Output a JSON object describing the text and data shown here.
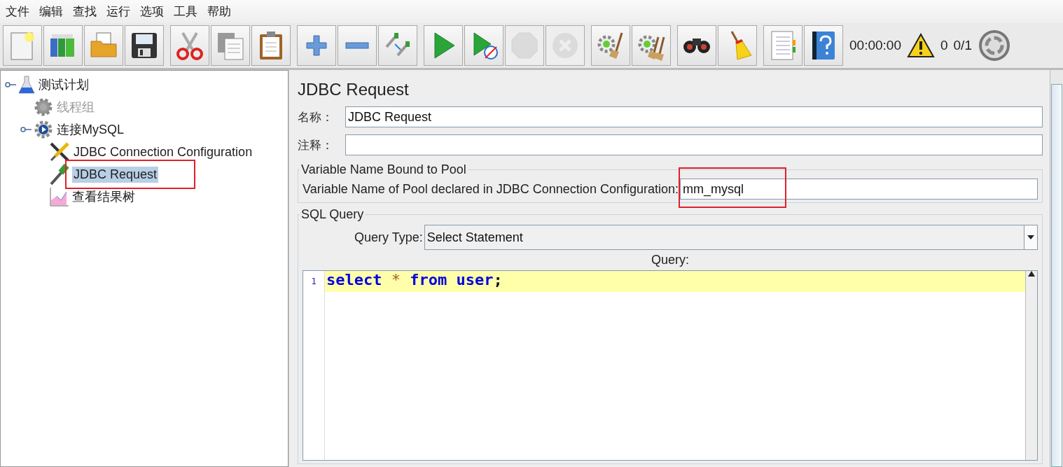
{
  "menu": [
    "文件",
    "编辑",
    "查找",
    "运行",
    "选项",
    "工具",
    "帮助"
  ],
  "toolbar": {
    "groups": [
      [
        {
          "disabled": false
        },
        {
          "disabled": false
        },
        {
          "disabled": false
        },
        {
          "disabled": false
        }
      ],
      [
        {
          "disabled": false
        },
        {
          "disabled": false
        },
        {
          "disabled": false
        }
      ],
      [
        {
          "disabled": false
        },
        {
          "disabled": false
        },
        {
          "disabled": false
        }
      ],
      [
        {
          "disabled": false
        },
        {
          "disabled": false
        },
        {
          "disabled": true
        },
        {
          "disabled": true
        }
      ],
      [
        {
          "disabled": false
        },
        {
          "disabled": false
        }
      ],
      [
        {
          "disabled": false
        },
        {
          "disabled": false
        }
      ],
      [
        {
          "disabled": false
        },
        {
          "disabled": false
        }
      ]
    ],
    "timer": "00:00:00",
    "warnings": "0",
    "threads": "0/1"
  },
  "tree": [
    {
      "label": "测试计划",
      "disabled": false,
      "selected": false,
      "highlighted": false,
      "children": [
        {
          "label": "线程组",
          "disabled": true,
          "selected": false,
          "highlighted": false
        },
        {
          "label": "连接MySQL",
          "disabled": false,
          "selected": false,
          "highlighted": false,
          "children": [
            {
              "label": "JDBC Connection Configuration",
              "disabled": false,
              "selected": false,
              "highlighted": false
            },
            {
              "label": "JDBC Request",
              "disabled": false,
              "selected": true,
              "highlighted": true
            },
            {
              "label": "查看结果树",
              "disabled": false,
              "selected": false,
              "highlighted": false
            }
          ]
        }
      ]
    }
  ],
  "panel": {
    "title": "JDBC Request",
    "name": {
      "label": "名称：",
      "value": "JDBC Request"
    },
    "comment": {
      "label": "注释："
    },
    "pool_section": {
      "title": "Variable Name Bound to Pool",
      "label": "Variable Name of Pool declared in JDBC Connection Configuration:",
      "value": "mm_mysql",
      "highlighted": true
    },
    "sql_section": {
      "title": "SQL Query",
      "query_type_label": "Query Type:",
      "query_type": "Select Statement",
      "query_label": "Query:",
      "lines": [
        {
          "number": "1",
          "highlighted": true,
          "tokens": [
            {
              "kind": "keyword",
              "text": "select"
            },
            {
              "kind": "operator",
              "text": "*"
            },
            {
              "kind": "keyword",
              "text": "from"
            },
            {
              "kind": "keyword",
              "text": "user"
            },
            {
              "kind": "punct",
              "text": ";"
            }
          ]
        }
      ]
    }
  }
}
